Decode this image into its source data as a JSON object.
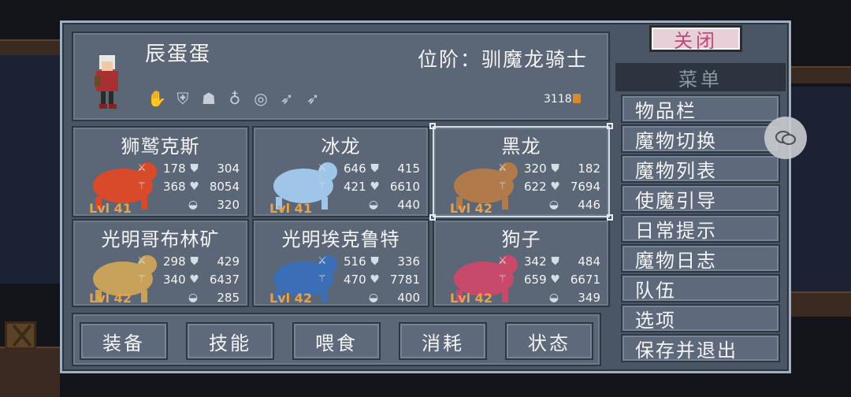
{
  "player": {
    "name": "辰蛋蛋",
    "rank": "位阶：驯魔龙骑士",
    "gold": "3118",
    "equip_icons": [
      "gloves-icon",
      "armor-icon",
      "helmet-icon",
      "amulet-icon",
      "ring-icon",
      "feather-icon",
      "feather-icon"
    ]
  },
  "monsters": [
    {
      "name": "狮鹫克斯",
      "level": "Lvl 41",
      "atk": "178",
      "def": "304",
      "mag": "368",
      "hp": "8054",
      "food": "320",
      "color": "#d84a2a"
    },
    {
      "name": "冰龙",
      "level": "Lvl 41",
      "atk": "646",
      "def": "415",
      "mag": "421",
      "hp": "6610",
      "food": "440",
      "color": "#9fc6e8"
    },
    {
      "name": "黑龙",
      "level": "Lvl 42",
      "atk": "320",
      "def": "182",
      "mag": "622",
      "hp": "7694",
      "food": "446",
      "color": "#b07a4a"
    },
    {
      "name": "光明哥布林矿",
      "level": "Lvl 42",
      "atk": "298",
      "def": "429",
      "mag": "340",
      "hp": "6437",
      "food": "285",
      "color": "#c8a25a"
    },
    {
      "name": "光明埃克鲁特",
      "level": "Lvl 42",
      "atk": "516",
      "def": "336",
      "mag": "470",
      "hp": "7781",
      "food": "400",
      "color": "#3a6fb8"
    },
    {
      "name": "狗子",
      "level": "Lvl 42",
      "atk": "342",
      "def": "484",
      "mag": "659",
      "hp": "6671",
      "food": "349",
      "color": "#c84a6a"
    }
  ],
  "actions": [
    "装备",
    "技能",
    "喂食",
    "消耗",
    "状态"
  ],
  "menu": {
    "close_label": "关闭",
    "title": "菜单",
    "items": [
      "物品栏",
      "魔物切换",
      "魔物列表",
      "使魔引导",
      "日常提示",
      "魔物日志",
      "队伍",
      "选项",
      "保存并退出"
    ]
  }
}
